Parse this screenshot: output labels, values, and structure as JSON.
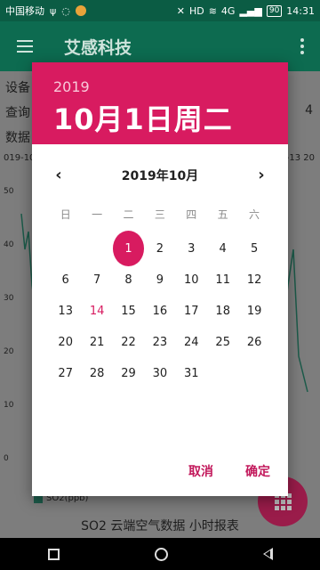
{
  "status": {
    "carrier": "中国移动",
    "network": "4G",
    "hd": "HD",
    "battery": "90",
    "time": "14:31"
  },
  "appbar": {
    "title": "艾感科技"
  },
  "background": {
    "row1": "设备",
    "row2": "查询",
    "row3": "数据",
    "row2_right": "4",
    "date_left": "019-10",
    "date_right": "0-13 20",
    "y_ticks": [
      "50",
      "40",
      "30",
      "20",
      "10",
      "0"
    ],
    "legend": "SO2(ppb)",
    "report_title": "SO2 云端空气数据 小时报表"
  },
  "dialog": {
    "year": "2019",
    "header_date": "10月1日周二",
    "month_label": "2019年10月",
    "weekdays": [
      "日",
      "一",
      "二",
      "三",
      "四",
      "五",
      "六"
    ],
    "days": [
      "1",
      "2",
      "3",
      "4",
      "5",
      "6",
      "7",
      "8",
      "9",
      "10",
      "11",
      "12",
      "13",
      "14",
      "15",
      "16",
      "17",
      "18",
      "19",
      "20",
      "21",
      "22",
      "23",
      "24",
      "25",
      "26",
      "27",
      "28",
      "29",
      "30",
      "31"
    ],
    "first_weekday_index": 2,
    "selected_day": "1",
    "today_day": "14",
    "cancel_label": "取消",
    "ok_label": "确定",
    "accent_color": "#d81b60"
  },
  "icons": {
    "prev": "chevron-left-icon",
    "next": "chevron-right-icon",
    "menu": "hamburger-icon",
    "more": "more-vert-icon"
  }
}
